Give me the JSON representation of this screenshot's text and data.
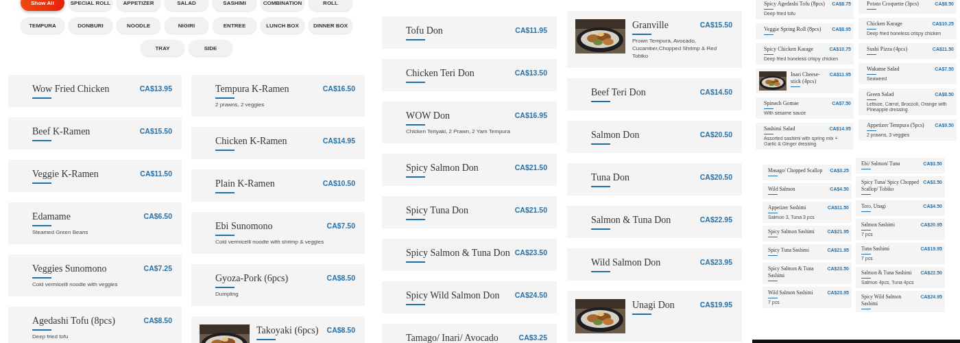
{
  "filters": [
    {
      "label": "Show All",
      "selected": true
    },
    {
      "label": "SPECIAL ROLL",
      "selected": false
    },
    {
      "label": "APPETIZER",
      "selected": false
    },
    {
      "label": "SALAD",
      "selected": false
    },
    {
      "label": "SASHIMI",
      "selected": false
    },
    {
      "label": "COMBINATION",
      "selected": false
    },
    {
      "label": "ROLL",
      "selected": false
    },
    {
      "label": "TEMPURA",
      "selected": false
    },
    {
      "label": "DONBURI",
      "selected": false
    },
    {
      "label": "NOODLE",
      "selected": false
    },
    {
      "label": "NIGIRI",
      "selected": false
    },
    {
      "label": "ENTREE",
      "selected": false
    },
    {
      "label": "LUNCH BOX",
      "selected": false
    },
    {
      "label": "DINNER BOX",
      "selected": false
    },
    {
      "label": "TRAY",
      "selected": false
    },
    {
      "label": "SIDE",
      "selected": false
    }
  ],
  "panels": [
    {
      "sections": [
        {
          "columns": [
            {
              "items": [
                {
                  "kind": "plain",
                  "name": "Wow Fried Chicken",
                  "price": "CA$13.95"
                },
                {
                  "kind": "plain",
                  "name": "Beef K-Ramen",
                  "price": "CA$15.50"
                },
                {
                  "kind": "plain",
                  "name": "Veggie K-Ramen",
                  "price": "CA$11.50"
                },
                {
                  "kind": "plain",
                  "name": "Edamame",
                  "price": "CA$6.50",
                  "description": "Steamed Green Beans"
                },
                {
                  "kind": "plain",
                  "name": "Veggies Sunomono",
                  "price": "CA$7.25",
                  "description": "Cold vermicelli noodle with veggies"
                },
                {
                  "kind": "plain",
                  "name": "Agedashi Tofu (8pcs)",
                  "price": "CA$8.50",
                  "description": "Deep fried tofu"
                }
              ]
            },
            {
              "items": [
                {
                  "kind": "plain",
                  "name": "Tempura K-Ramen",
                  "price": "CA$16.50",
                  "description": "2 prawns, 2 veggies"
                },
                {
                  "kind": "plain",
                  "name": "Chicken K-Ramen",
                  "price": "CA$14.95"
                },
                {
                  "kind": "plain",
                  "name": "Plain K-Ramen",
                  "price": "CA$10.50"
                },
                {
                  "kind": "plain",
                  "name": "Ebi Sunomono",
                  "price": "CA$7.50",
                  "description": "Cold vermicelli noodle with shrimp & veggies"
                },
                {
                  "kind": "plain",
                  "name": "Gyoza-Pork (6pcs)",
                  "price": "CA$8.50",
                  "description": "Dumpling"
                },
                {
                  "kind": "picture",
                  "name": "Takoyaki (6pcs)",
                  "price": "CA$8.50"
                }
              ]
            }
          ]
        }
      ]
    },
    {
      "sections": [
        {
          "columns": [
            {
              "items": [
                {
                  "kind": "plain",
                  "name": "Tofu Don",
                  "price": "CA$11.95"
                },
                {
                  "kind": "plain",
                  "name": "Chicken Teri Don",
                  "price": "CA$13.50"
                },
                {
                  "kind": "plain",
                  "name": "WOW Don",
                  "price": "CA$16.95",
                  "description": "Chicken Teriyaki, 2 Prawn, 2 Yam Tempura"
                },
                {
                  "kind": "plain",
                  "name": "Spicy Salmon Don",
                  "price": "CA$21.50"
                },
                {
                  "kind": "plain",
                  "name": "Spicy Tuna Don",
                  "price": "CA$21.50"
                },
                {
                  "kind": "plain",
                  "name": "Spicy Salmon & Tuna Don",
                  "price": "CA$23.50"
                },
                {
                  "kind": "plain",
                  "name": "Spicy Wild Salmon Don",
                  "price": "CA$24.50"
                },
                {
                  "kind": "plain",
                  "name": "Tamago/ Inari/ Avocado",
                  "price": "CA$3.25"
                }
              ]
            }
          ]
        }
      ]
    },
    {
      "sections": [
        {
          "columns": [
            {
              "items": [
                {
                  "kind": "picture",
                  "name": "Granville",
                  "price": "CA$15.50",
                  "description": "Prown Tempura, Avocado, Cucamber,Chopped Shrimp & Red Tobiko"
                },
                {
                  "kind": "plain",
                  "name": "Beef Teri Don",
                  "price": "CA$14.50"
                },
                {
                  "kind": "plain",
                  "name": "Salmon Don",
                  "price": "CA$20.50"
                },
                {
                  "kind": "plain",
                  "name": "Tuna Don",
                  "price": "CA$20.50"
                },
                {
                  "kind": "plain",
                  "name": "Salmon & Tuna Don",
                  "price": "CA$22.95"
                },
                {
                  "kind": "plain",
                  "name": "Wild Salmon Don",
                  "price": "CA$23.95"
                },
                {
                  "kind": "picture",
                  "name": "Unagi Don",
                  "price": "CA$19.95"
                }
              ]
            }
          ]
        }
      ]
    },
    {
      "sections": [
        {
          "columns": [
            {
              "items": [
                {
                  "kind": "plain",
                  "name": "Spicy Agedashi Tofu (8pcs)",
                  "price": "CA$8.75",
                  "description": "Deep fried tofu"
                },
                {
                  "kind": "plain",
                  "name": "Veggie Spring Roll (8pcs)",
                  "price": "CA$8.95"
                },
                {
                  "kind": "plain",
                  "name": "Spicy Chicken Karage",
                  "price": "CA$10.75",
                  "description": "Deep fried boneless crispy chicken"
                },
                {
                  "kind": "picture",
                  "name": "Inari Cheese-stick (4pcs)",
                  "price": "CA$11.95"
                },
                {
                  "kind": "plain",
                  "name": "Spinach Gomae",
                  "price": "CA$7.50",
                  "description": "With sesame sauce"
                },
                {
                  "kind": "plain",
                  "name": "Sashimi Salad",
                  "price": "CA$14.95",
                  "description": "Assorted sashimi with spring mix + Garlic & Ginger dressing"
                }
              ]
            },
            {
              "items": [
                {
                  "kind": "plain",
                  "name": "Potato Croquette (3pcs)",
                  "price": "CA$8.50"
                },
                {
                  "kind": "plain",
                  "name": "Chicken Karage",
                  "price": "CA$10.25",
                  "description": "Deep fried boneless crispy chicken"
                },
                {
                  "kind": "plain",
                  "name": "Sushi Pizza (4pcs)",
                  "price": "CA$11.50"
                },
                {
                  "kind": "plain",
                  "name": "Wakame Salad",
                  "price": "CA$7.50",
                  "description": "Seaweed"
                },
                {
                  "kind": "plain",
                  "name": "Green Salad",
                  "price": "CA$8.50",
                  "description": "Lettuce, Carrot, Broccoli, Orange with Pineapple dressing"
                },
                {
                  "kind": "plain",
                  "name": "Appetizer Tempura (5pcs)",
                  "price": "CA$9.50",
                  "description": "2 prawns, 3 veggies"
                }
              ]
            }
          ]
        },
        {
          "columns": [
            {
              "items": [
                {
                  "kind": "plain",
                  "name": "Masago/ Chopped Scallop",
                  "price": "CA$3.25"
                },
                {
                  "kind": "plain",
                  "name": "Wild Salmon",
                  "price": "CA$4.50"
                },
                {
                  "kind": "plain",
                  "name": "Appetizer Sashimi",
                  "price": "CA$11.50",
                  "description": "Salmon 3, Tuna 3 pcs"
                },
                {
                  "kind": "plain",
                  "name": "Spicy Salmon Sashimi",
                  "price": "CA$21.95"
                },
                {
                  "kind": "plain",
                  "name": "Spicy Tuna Sashimi",
                  "price": "CA$21.95"
                },
                {
                  "kind": "plain",
                  "name": "Spicy Salmon & Tuna Sashimi",
                  "price": "CA$23.50"
                },
                {
                  "kind": "plain",
                  "name": "Wild Salmon Sashimi",
                  "price": "CA$23.95",
                  "description": "7 pcs"
                }
              ]
            },
            {
              "items": [
                {
                  "kind": "plain",
                  "name": "Ebi/ Salmon/ Tuna",
                  "price": "CA$3.50"
                },
                {
                  "kind": "plain",
                  "name": "Spicy Tuna/ Spicy Chopped Scallop/ Tobiko",
                  "price": "CA$3.50"
                },
                {
                  "kind": "plain",
                  "name": "Toro, Unagi",
                  "price": "CA$4.50"
                },
                {
                  "kind": "plain",
                  "name": "Salmon Sashimi",
                  "price": "CA$20.95",
                  "description": "7 pcs"
                },
                {
                  "kind": "plain",
                  "name": "Tuna Sashimi",
                  "price": "CA$19.95",
                  "description": "7 pcs"
                },
                {
                  "kind": "plain",
                  "name": "Salmon & Tuna Sashimi",
                  "price": "CA$22.50",
                  "description": "Salmon 4pcs, Tuna 4pcs"
                },
                {
                  "kind": "plain",
                  "name": "Spicy Wild Salmon Sashimi",
                  "price": "CA$24.95"
                }
              ]
            }
          ]
        }
      ]
    }
  ]
}
